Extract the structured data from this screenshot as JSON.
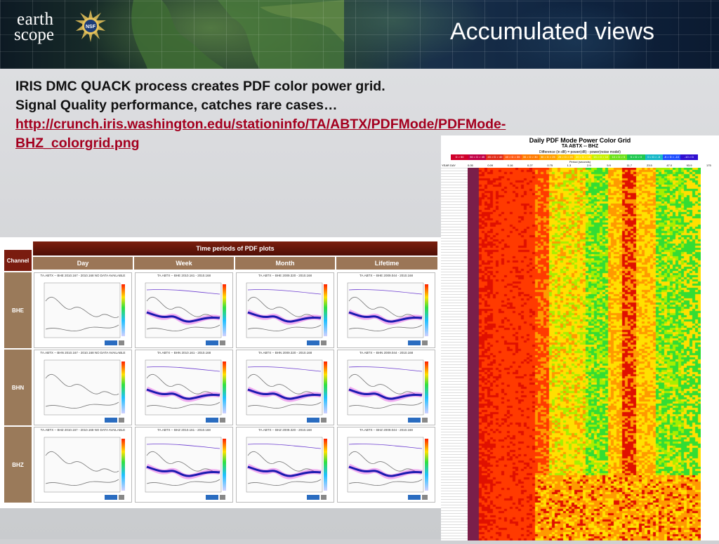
{
  "slide": {
    "title": "Accumulated views",
    "bullets": [
      "IRIS DMC QUACK process creates PDF color power grid.",
      "Signal Quality performance, catches rare cases…"
    ],
    "link_line1": "http://crunch.iris.washington.edu/stationinfo/TA/ABTX/PDFMode/PDFMode-",
    "link_line2": "BHZ_colorgrid.png"
  },
  "logos": {
    "earthscope_line1": "earth",
    "earthscope_line2": "scope",
    "nsf": "NSF"
  },
  "pdf_table": {
    "header": "Time periods of PDF plots",
    "channel_header": "Channel",
    "periods": [
      "Day",
      "Week",
      "Month",
      "Lifetime"
    ],
    "channels": [
      "BHE",
      "BHN",
      "BHZ"
    ],
    "cell_titles": [
      [
        "TA.ABTX -- BHE 2010.167 - 2010.168 NO DATA AVAILABLE",
        "TA.ABTX -- BHE 2010.161 - 2010.168",
        "TA.ABTX -- BHE 2009.320 - 2010.168",
        "TA.ABTX -- BHE 2009.044 - 2010.168"
      ],
      [
        "TA.ABTX -- BHN 2010.167 - 2010.168 NO DATA AVAILABLE",
        "TA.ABTX -- BHN 2010.161 - 2010.168",
        "TA.ABTX -- BHN 2009.320 - 2010.168",
        "TA.ABTX -- BHN 2009.044 - 2010.168"
      ],
      [
        "TA.ABTX -- BHZ 2010.167 - 2010.168 NO DATA AVAILABLE",
        "TA.ABTX -- BHZ 2010.161 - 2010.168",
        "TA.ABTX -- BHZ 2009.320 - 2010.168",
        "TA.ABTX -- BHZ 2009.044 - 2010.168"
      ]
    ]
  },
  "color_grid": {
    "title": "Daily PDF Mode Power Color Grid",
    "station": "TA ABTX -- BHZ",
    "difference_label": "Difference (in dB) = power(dB) - power(noise model)",
    "legend": [
      "D > 50",
      "50 > D > 45",
      "45 > D > 40",
      "40 > D > 35",
      "35 > D > 30",
      "30 > D > 25",
      "25 > D > 20",
      "20 > D > 15",
      "15 > D > 10",
      "10 > D > 5",
      "5 > D > 0",
      "0 > D > -5",
      "-5 > D > -10",
      "-10 > D"
    ],
    "legend_colors": [
      "#d0002a",
      "#c10045",
      "#e02b18",
      "#ff5a14",
      "#ff7a00",
      "#ff9e00",
      "#ffbe00",
      "#ffe000",
      "#c8f000",
      "#6ee01a",
      "#1fc850",
      "#18b8c8",
      "#2050ff",
      "#3010d0"
    ],
    "period_label": "Period (seconds)",
    "yearday_label": "YEAR DAY",
    "period_ticks": [
      "0.05",
      "0.09",
      "0.16",
      "0.27",
      "0.75",
      "1.3",
      "2.9",
      "5.9",
      "11.7",
      "23.5",
      "47.0",
      "93.9",
      "175"
    ],
    "palette": {
      "bg": "#ff3a00",
      "red": "#e01000",
      "orange": "#ff9a00",
      "yellow": "#ffe000",
      "lime": "#a8ee00",
      "green": "#33dd33",
      "purple": "#7a1f4a"
    }
  }
}
